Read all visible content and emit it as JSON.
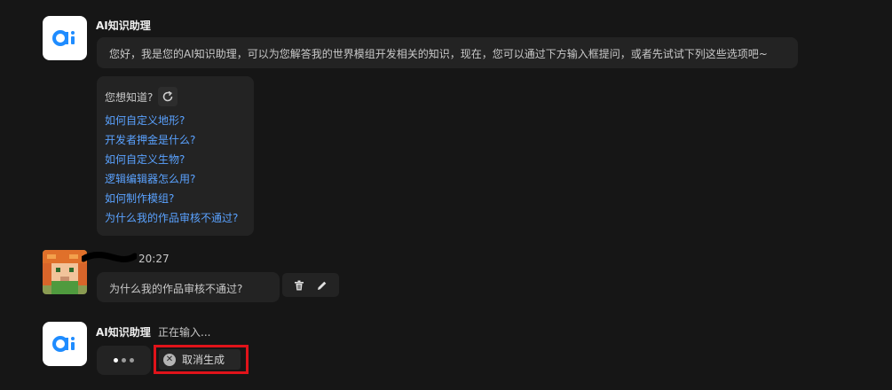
{
  "assistant": {
    "name": "AI知识助理",
    "greeting": "您好，我是您的AI知识助理，可以为您解答我的世界模组开发相关的知识，现在，您可以通过下方输入框提问，或者先试试下列这些选项吧~"
  },
  "suggestions": {
    "heading": "您想知道?",
    "refresh_icon": "refresh-icon",
    "items": [
      "如何自定义地形?",
      "开发者押金是什么?",
      "如何自定义生物?",
      "逻辑编辑器怎么用?",
      "如何制作模组?",
      "为什么我的作品审核不通过?"
    ],
    "link_color": "#5aa2ff"
  },
  "user_message": {
    "time": "20:27",
    "text": "为什么我的作品审核不通过?",
    "actions": [
      "delete-icon",
      "edit-icon"
    ]
  },
  "reply": {
    "name": "AI知识助理",
    "status": "正在输入...",
    "cancel_label": "取消生成",
    "highlight_color": "#e0131a"
  }
}
